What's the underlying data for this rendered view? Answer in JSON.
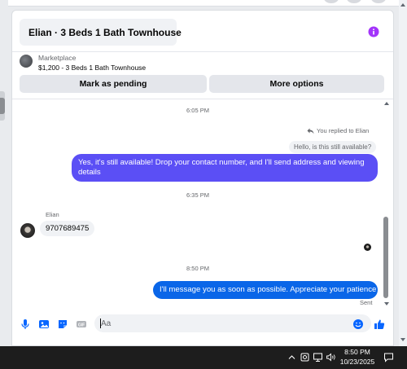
{
  "colors": {
    "accent_purple": "#5b4ff5",
    "accent_blue": "#0a66e8",
    "icon_blue": "#0866ff",
    "info_purple": "#a334fa"
  },
  "header": {
    "title": "Elian · 3 Beds 1 Bath Townhouse",
    "info_icon": "info-icon"
  },
  "listing": {
    "label": "Marketplace",
    "title": "$1,200 - 3 Beds 1 Bath Townhouse"
  },
  "actions": {
    "pending_label": "Mark as pending",
    "more_label": "More options"
  },
  "messages": {
    "time1": "6:05 PM",
    "reply_note": "You replied to Elian",
    "quoted": "Hello, is this still available?",
    "out1": "Yes, it's still available! Drop your contact number, and I'll send address and viewing details",
    "time2": "6:35 PM",
    "sender": "Elian",
    "in1": "9707689475",
    "time3": "8:50 PM",
    "out2": "I'll message you as soon as possible. Appreciate your patience",
    "status": "Sent"
  },
  "composer": {
    "placeholder": "Aa",
    "icons": [
      "microphone-icon",
      "photo-icon",
      "sticker-icon",
      "gif-icon",
      "emoji-icon",
      "thumbs-up-icon"
    ]
  },
  "taskbar": {
    "time": "8:50 PM",
    "date": "10/23/2025",
    "icons": [
      "chevron-up-icon",
      "camera-icon",
      "network-icon",
      "volume-icon",
      "notification-icon"
    ]
  }
}
